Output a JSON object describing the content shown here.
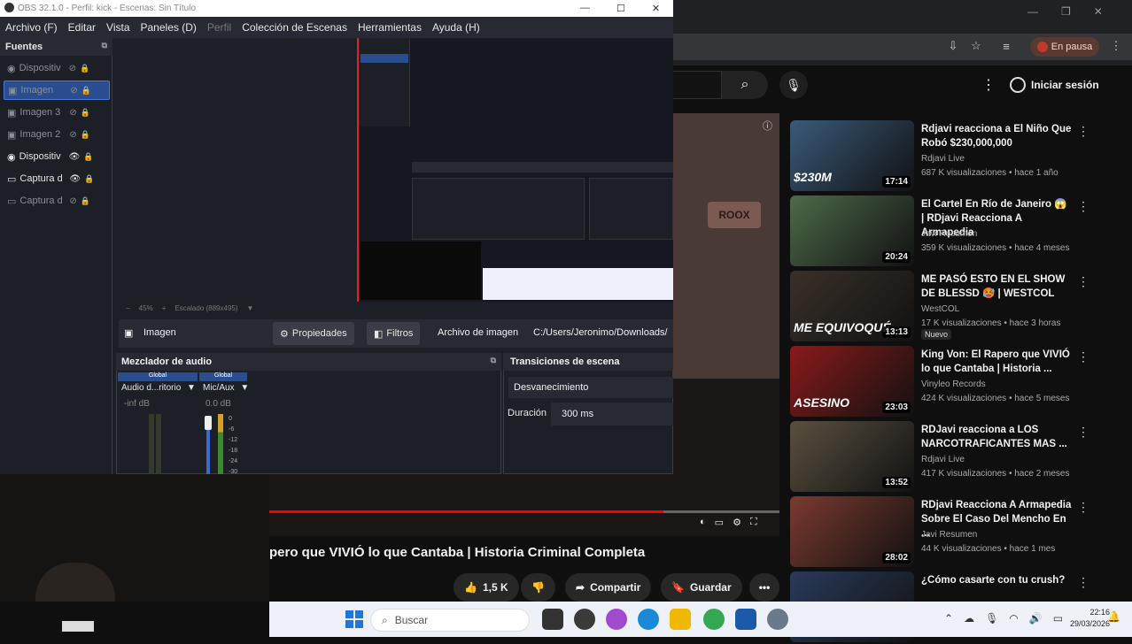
{
  "obs": {
    "title": "OBS 32.1.0 - Perfil: kick - Escenas: Sin Título",
    "menu": [
      "Archivo (F)",
      "Editar",
      "Vista",
      "Paneles (D)",
      "Perfil",
      "Colección de Escenas",
      "Herramientas",
      "Ayuda (H)"
    ],
    "sources_header": "Fuentes",
    "sources": [
      {
        "label": "Dispositiv",
        "visible": false,
        "selected": false,
        "icon": "camera-icon"
      },
      {
        "label": "Imagen",
        "visible": false,
        "selected": true,
        "icon": "image-icon"
      },
      {
        "label": "Imagen 3",
        "visible": false,
        "selected": false,
        "icon": "image-icon"
      },
      {
        "label": "Imagen 2",
        "visible": false,
        "selected": false,
        "icon": "image-icon"
      },
      {
        "label": "Dispositiv",
        "visible": true,
        "selected": false,
        "icon": "camera-icon"
      },
      {
        "label": "Captura d",
        "visible": true,
        "selected": false,
        "icon": "monitor-icon"
      },
      {
        "label": "Captura d",
        "visible": false,
        "selected": false,
        "icon": "monitor-icon"
      }
    ],
    "preview_bar": {
      "zoom": "45%",
      "scale": "Escalado (889x495)"
    },
    "props_bar": {
      "source_name": "Imagen",
      "properties": "Propiedades",
      "filters": "Filtros",
      "file_label": "Archivo de imagen",
      "file_path": "C:/Users/Jeronimo/Downloads/"
    },
    "mixer": {
      "title": "Mezclador de audio",
      "channels": [
        {
          "header": "Global",
          "name": "Audio d...ritorio",
          "db": "-inf dB"
        },
        {
          "header": "Global",
          "name": "Mic/Aux",
          "db": "0.0 dB"
        }
      ],
      "scale": [
        "0",
        "-6",
        "-12",
        "-18",
        "-24",
        "-30"
      ]
    },
    "transitions": {
      "title": "Transiciones de escena",
      "selected": "Desvanecimiento",
      "duration_label": "Duración",
      "duration_value": "300 ms"
    }
  },
  "chrome": {
    "pause_label": "En pausa"
  },
  "youtube": {
    "login_label": "Iniciar sesión",
    "video_title": "pero que VIVIÓ lo que Cantaba | Historia Criminal Completa",
    "actions": {
      "likes": "1,5 K",
      "share": "Compartir",
      "save": "Guardar"
    },
    "recommendations": [
      {
        "title": "Rdjavi reacciona a El Niño Que Robó $230,000,000",
        "channel": "Rdjavi Live",
        "meta": "687 K visualizaciones • hace 1 año",
        "duration": "17:14",
        "thumb_text": "$230M",
        "thumb_color": "#3a5a7a"
      },
      {
        "title": "El Cartel En Río de Janeiro 😱 | RDjavi Reacciona A Armapedia",
        "channel": "Javi Resumen",
        "meta": "359 K visualizaciones • hace 4 meses",
        "duration": "20:24",
        "thumb_text": "",
        "thumb_color": "#4e6a4a"
      },
      {
        "title": "ME PASÓ ESTO EN EL SHOW DE BLESSD 🥵 | WESTCOL",
        "channel": "WestCOL",
        "meta": "17 K visualizaciones • hace 3 horas",
        "duration": "13:13",
        "badge": "Nuevo",
        "thumb_text": "ME EQUIVOQUÉ",
        "thumb_color": "#3a3028"
      },
      {
        "title": "King Von: El Rapero que VIVIÓ lo que Cantaba | Historia ...",
        "channel": "Vinyleo Records",
        "meta": "424 K visualizaciones • hace 5 meses",
        "duration": "23:03",
        "thumb_text": "ASESINO",
        "thumb_color": "#8a1a1a"
      },
      {
        "title": "RDJavi reacciona a LOS NARCOTRAFICANTES MAS ...",
        "channel": "Rdjavi Live",
        "meta": "417 K visualizaciones • hace 2 meses",
        "duration": "13:52",
        "thumb_text": "",
        "thumb_color": "#5a5040"
      },
      {
        "title": "RDjavi Reacciona A Armapedia Sobre El Caso Del Mencho En ...",
        "channel": "Javi Resumen",
        "meta": "44 K visualizaciones • hace 1 mes",
        "duration": "28:02",
        "thumb_text": "",
        "thumb_color": "#7a3a30"
      },
      {
        "title": "¿Cómo casarte con tu crush?",
        "channel": "",
        "meta": "",
        "duration": "",
        "thumb_text": "",
        "thumb_color": "#2a3a5a"
      }
    ]
  },
  "taskbar": {
    "search_placeholder": "Buscar",
    "time": "22:16",
    "date": "29/03/2026"
  }
}
